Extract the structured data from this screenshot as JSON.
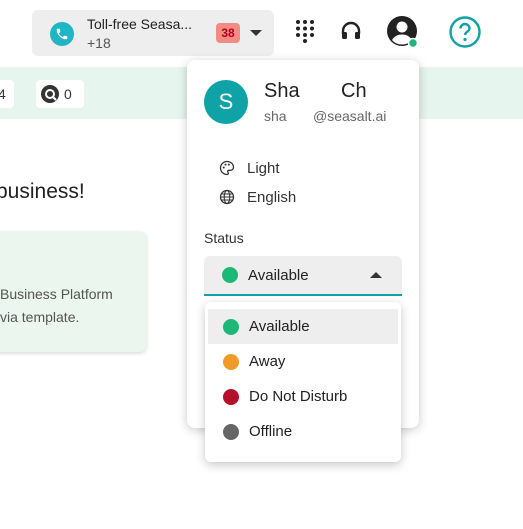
{
  "topbar": {
    "line_title": "Toll-free Seasa...",
    "line_number_prefix": "+18",
    "unread_count": "38",
    "icons": [
      "phone-icon",
      "dialpad-icon",
      "headset-icon",
      "account-icon",
      "help-icon"
    ]
  },
  "background": {
    "chip_count_1": "4",
    "chip_count_2": "0",
    "heading": "business!",
    "card_line_1": "Business Platform",
    "card_line_2": "via template."
  },
  "profile": {
    "avatar_initial": "S",
    "first_name": "Sha",
    "last_name": "Ch",
    "handle_user": "sha",
    "handle_domain": "@seasalt.ai",
    "theme_label": "Light",
    "language_label": "English",
    "status_label": "Status",
    "status_value": "Available"
  },
  "status_options": [
    {
      "label": "Available",
      "color": "#1db877"
    },
    {
      "label": "Away",
      "color": "#f29a28"
    },
    {
      "label": "Do Not Disturb",
      "color": "#b5102b"
    },
    {
      "label": "Offline",
      "color": "#666666"
    }
  ],
  "colors": {
    "accent_teal": "#12a1a6",
    "available_green": "#1db877",
    "mint_background": "#e6f5ee"
  }
}
